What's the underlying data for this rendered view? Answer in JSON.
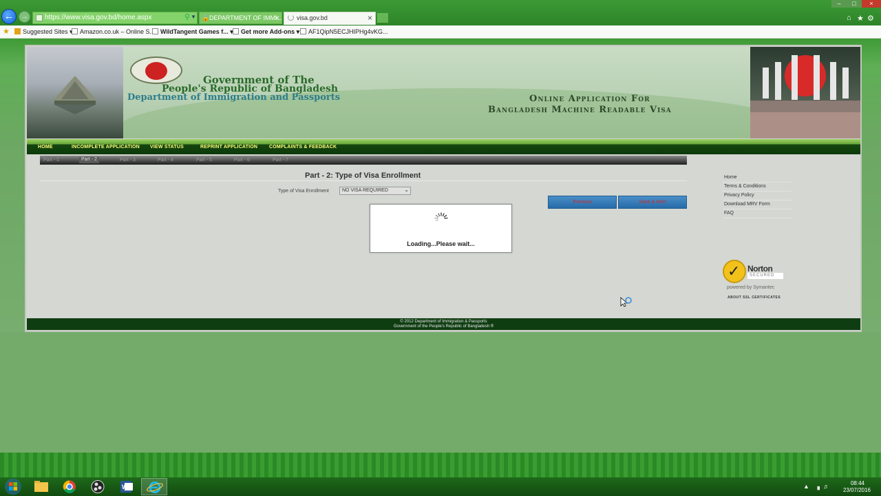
{
  "browser": {
    "address_url": "https://www.visa.gov.bd/home.aspx",
    "tabs": [
      {
        "label": "DEPARTMENT OF IMMI..."
      },
      {
        "label": "visa.gov.bd"
      }
    ],
    "favorites": [
      {
        "label": "Suggested Sites ▾"
      },
      {
        "label": "Amazon.co.uk – Online S..."
      },
      {
        "label": "WildTangent Games f...  ▾"
      },
      {
        "label": "Get more Add-ons ▾"
      },
      {
        "label": "AF1QipN5ECJHIPHg4vKG..."
      }
    ]
  },
  "banner": {
    "gov_line1": "Government of The",
    "gov_line2": "People's Republic of Bangladesh",
    "gov_line3": "Department of Immigration and Passports",
    "online_line1": "Online  Application For",
    "online_line2": "Bangladesh Machine Readable Visa"
  },
  "nav": {
    "items": [
      {
        "label": "HOME"
      },
      {
        "label": "INCOMPLETE APPLICATION"
      },
      {
        "label": "VIEW STATUS"
      },
      {
        "label": "REPRINT APPLICATION"
      },
      {
        "label": "COMPLAINTS & FEEDBACK"
      }
    ]
  },
  "steps": [
    "Part - 1",
    "Part - 2",
    "Part - 3",
    "Part - 4",
    "Part - 5",
    "Part - 6",
    "Part - 7"
  ],
  "form": {
    "title": "Part - 2: Type of Visa Enrollment",
    "visa_type_label": "Type of Visa Enrollment",
    "visa_type_value": "NO VISA REQUIRED",
    "previous_label": "Previous",
    "save_next_label": "Save & Next"
  },
  "loading": {
    "text": "Loading...Please wait..."
  },
  "side_links": [
    {
      "label": "Home"
    },
    {
      "label": "Terms & Conditions"
    },
    {
      "label": "Privacy Policy"
    },
    {
      "label": "Download MRV Form"
    },
    {
      "label": "FAQ"
    }
  ],
  "norton": {
    "name": "Norton",
    "secured": "SECURED",
    "powered": "powered by Symantec",
    "ssl": "ABOUT SSL CERTIFICATES"
  },
  "footer": {
    "line1": "© 2012 Department of Immigration & Passports",
    "line2": "Government of the People's Republic of Bangladesh ®"
  },
  "taskbar": {
    "time": "08:44",
    "date": "23/07/2016"
  },
  "colors": {
    "chrome_green": "#3c9a35",
    "nav_text": "#ffff7a",
    "button_blue": "#276ca9",
    "button_text": "#c82b2b",
    "footer_bg": "#0f3d12"
  }
}
